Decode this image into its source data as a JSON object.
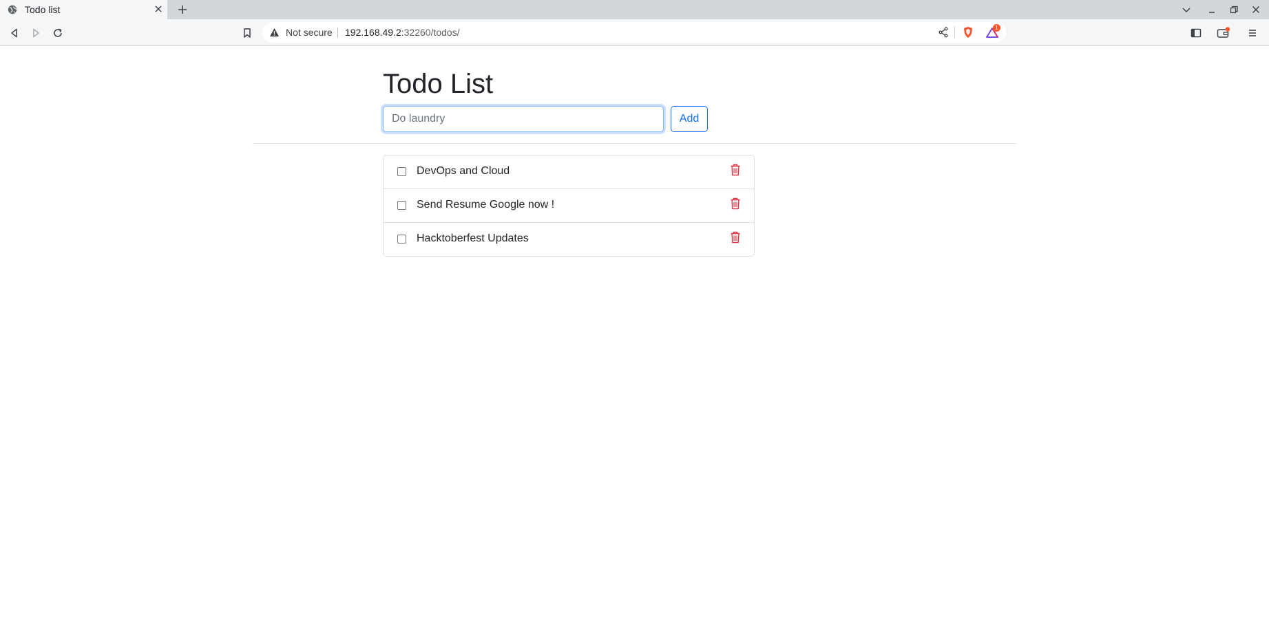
{
  "browser": {
    "tab_title": "Todo list",
    "security_label": "Not secure",
    "url_host": "192.168.49.2",
    "url_rest": ":32260/todos/",
    "rewards_badge": "1"
  },
  "page": {
    "title": "Todo List",
    "input_placeholder": "Do laundry",
    "add_label": "Add",
    "todos": [
      {
        "text": "DevOps and Cloud",
        "done": false
      },
      {
        "text": "Send Resume Google now !",
        "done": false
      },
      {
        "text": "Hacktoberfest Updates",
        "done": false
      }
    ]
  },
  "colors": {
    "accent": "#0d6efd",
    "danger": "#dc3545"
  }
}
